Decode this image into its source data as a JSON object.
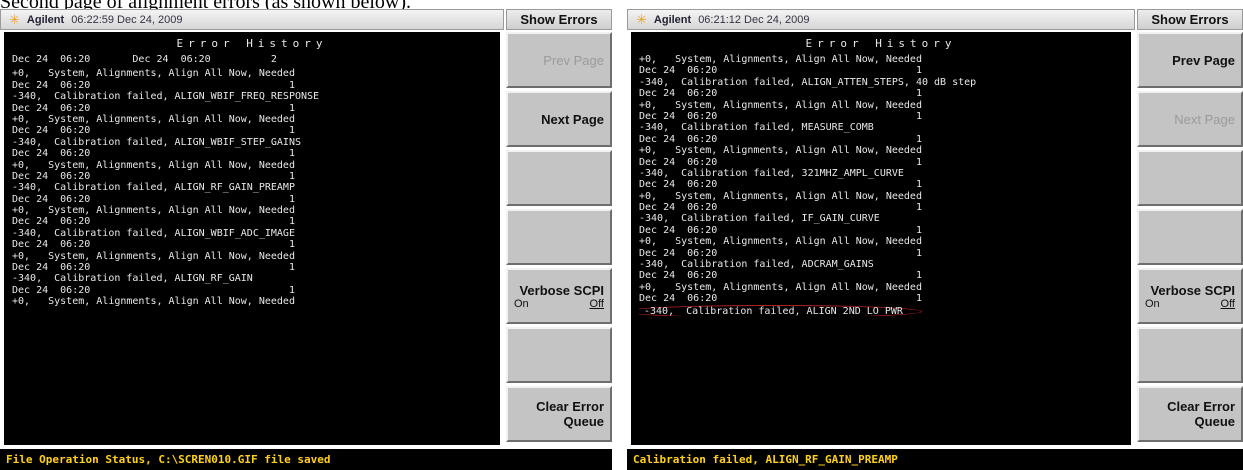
{
  "caption": "Second page of alignment errors (as shown below).",
  "panes": [
    {
      "title": {
        "brand": "Agilent",
        "timestamp": "06:22:59  Dec 24, 2009"
      },
      "menu_title": "Show Errors",
      "screen_title": "Error History",
      "lines": [
        {
          "kind": "header",
          "text": "Dec 24  06:20       Dec 24  06:20          2"
        },
        {
          "text": "+0,   System, Alignments, Align All Now, Needed"
        },
        {
          "text": "Dec 24  06:20                                 1"
        },
        {
          "text": "-340,  Calibration failed, ALIGN_WBIF_FREQ_RESPONSE"
        },
        {
          "text": "Dec 24  06:20                                 1"
        },
        {
          "text": "+0,   System, Alignments, Align All Now, Needed"
        },
        {
          "text": "Dec 24  06:20                                 1"
        },
        {
          "text": "-340,  Calibration failed, ALIGN_WBIF_STEP_GAINS"
        },
        {
          "text": "Dec 24  06:20                                 1"
        },
        {
          "text": "+0,   System, Alignments, Align All Now, Needed"
        },
        {
          "text": "Dec 24  06:20                                 1"
        },
        {
          "text": "-340,  Calibration failed, ALIGN_RF_GAIN_PREAMP"
        },
        {
          "text": "Dec 24  06:20                                 1"
        },
        {
          "text": "+0,   System, Alignments, Align All Now, Needed"
        },
        {
          "text": "Dec 24  06:20                                 1"
        },
        {
          "text": "-340,  Calibration failed, ALIGN_WBIF_ADC_IMAGE"
        },
        {
          "text": "Dec 24  06:20                                 1"
        },
        {
          "text": "+0,   System, Alignments, Align All Now, Needed"
        },
        {
          "text": "Dec 24  06:20                                 1"
        },
        {
          "text": "-340,  Calibration failed, ALIGN_RF_GAIN"
        },
        {
          "text": "Dec 24  06:20                                 1"
        },
        {
          "text": "+0,   System, Alignments, Align All Now, Needed"
        }
      ],
      "softkeys": {
        "prev_page": "Prev Page",
        "next_page": "Next Page",
        "verbose_label": "Verbose SCPI",
        "verbose_on": "On",
        "verbose_off": "Off",
        "clear_line1": "Clear Error",
        "clear_line2": "Queue"
      },
      "softkey_state": {
        "prev_page": "disabled",
        "next_page": "enabled"
      },
      "status": "File Operation Status, C:\\SCREN010.GIF file saved"
    },
    {
      "title": {
        "brand": "Agilent",
        "timestamp": "06:21:12  Dec 24, 2009"
      },
      "menu_title": "Show Errors",
      "screen_title": "Error History",
      "lines": [
        {
          "text": "+0,   System, Alignments, Align All Now, Needed"
        },
        {
          "text": "Dec 24  06:20                                 1"
        },
        {
          "text": "-340,  Calibration failed, ALIGN_ATTEN_STEPS, 40 dB step"
        },
        {
          "text": "Dec 24  06:20                                 1"
        },
        {
          "text": "+0,   System, Alignments, Align All Now, Needed"
        },
        {
          "text": "Dec 24  06:20                                 1"
        },
        {
          "text": "-340,  Calibration failed, MEASURE_COMB"
        },
        {
          "text": "Dec 24  06:20                                 1"
        },
        {
          "text": "+0,   System, Alignments, Align All Now, Needed"
        },
        {
          "text": "Dec 24  06:20                                 1"
        },
        {
          "text": "-340,  Calibration failed, 321MHZ_AMPL_CURVE"
        },
        {
          "text": "Dec 24  06:20                                 1"
        },
        {
          "text": "+0,   System, Alignments, Align All Now, Needed"
        },
        {
          "text": "Dec 24  06:20                                 1"
        },
        {
          "text": "-340,  Calibration failed, IF_GAIN_CURVE"
        },
        {
          "text": "Dec 24  06:20                                 1"
        },
        {
          "text": "+0,   System, Alignments, Align All Now, Needed"
        },
        {
          "text": "Dec 24  06:20                                 1"
        },
        {
          "text": "-340,  Calibration failed, ADCRAM_GAINS"
        },
        {
          "text": "Dec 24  06:20                                 1"
        },
        {
          "text": "+0,   System, Alignments, Align All Now, Needed"
        },
        {
          "text": "Dec 24  06:20                                 1"
        },
        {
          "kind": "highlight",
          "text": "-340,  Calibration failed, ALIGN_2ND_LO_PWR"
        }
      ],
      "softkeys": {
        "prev_page": "Prev Page",
        "next_page": "Next Page",
        "verbose_label": "Verbose SCPI",
        "verbose_on": "On",
        "verbose_off": "Off",
        "clear_line1": "Clear Error",
        "clear_line2": "Queue"
      },
      "softkey_state": {
        "prev_page": "enabled",
        "next_page": "disabled"
      },
      "status": "Calibration failed, ALIGN_RF_GAIN_PREAMP"
    }
  ],
  "colors": {
    "screen_bg": "#000000",
    "screen_text": "#e8e8e8",
    "status_text": "#ffd21a",
    "softkey_bg": "#c4c4c4",
    "highlight_ring": "#b02020"
  }
}
